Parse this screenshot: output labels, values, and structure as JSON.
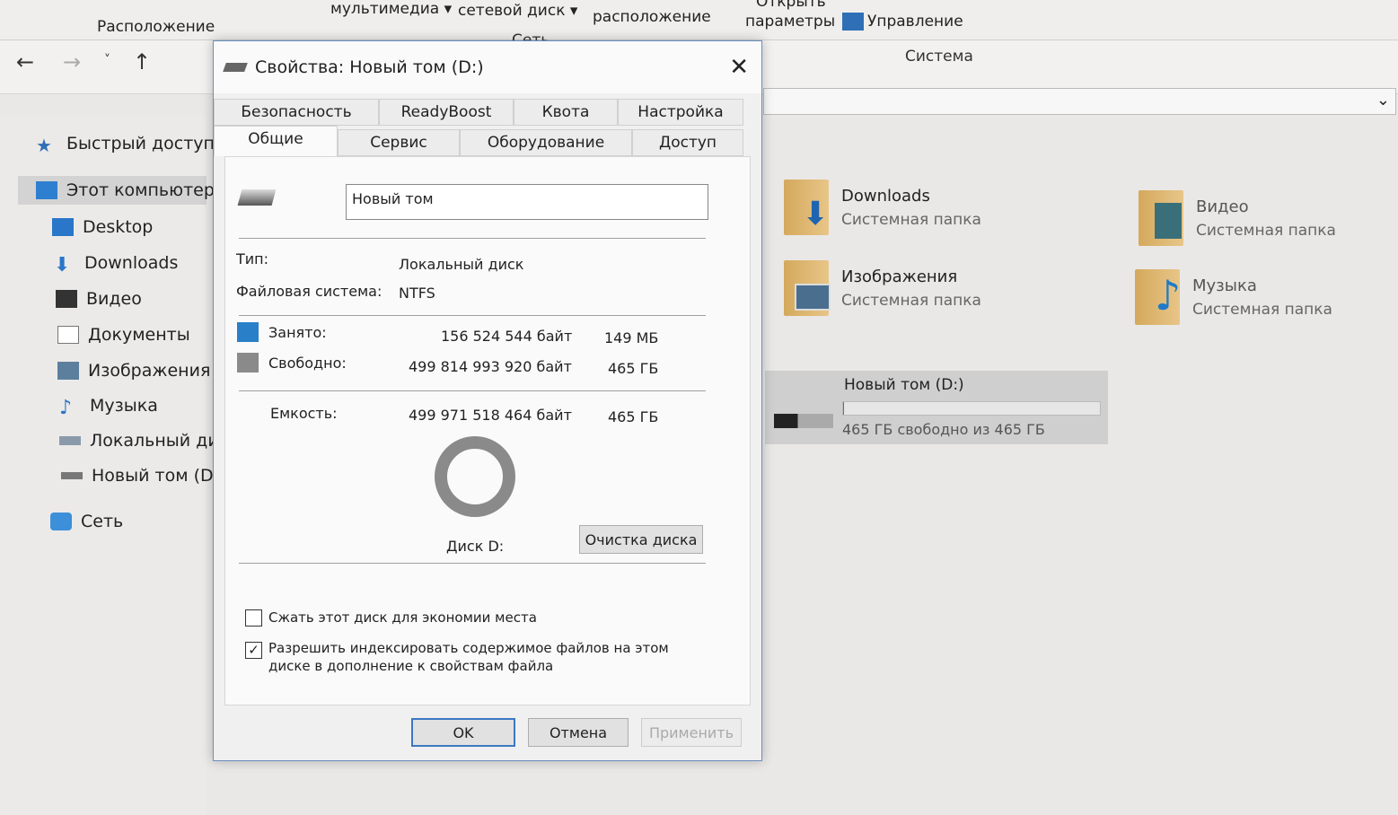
{
  "ribbon": {
    "items": [
      "мультимедиа ▾",
      "сетевой диск ▾",
      "расположение",
      "параметры",
      "Управление",
      "Открыть"
    ],
    "groups": [
      "Расположение",
      "Сеть",
      "Система"
    ]
  },
  "sidebar": {
    "items": [
      {
        "label": "Быстрый доступ",
        "icon": "star-icon"
      },
      {
        "label": "Этот компьютер",
        "icon": "computer-icon"
      },
      {
        "label": "Desktop",
        "icon": "desktop-icon"
      },
      {
        "label": "Downloads",
        "icon": "download-icon"
      },
      {
        "label": "Видео",
        "icon": "video-icon"
      },
      {
        "label": "Документы",
        "icon": "document-icon"
      },
      {
        "label": "Изображения",
        "icon": "image-icon"
      },
      {
        "label": "Музыка",
        "icon": "music-icon"
      },
      {
        "label": "Локальный диск",
        "icon": "drive-icon"
      },
      {
        "label": "Новый том (D:)",
        "icon": "drive-icon"
      },
      {
        "label": "Сеть",
        "icon": "network-icon"
      }
    ]
  },
  "main": {
    "folders": [
      {
        "name": "Downloads",
        "desc": "Системная папка"
      },
      {
        "name": "Видео",
        "desc": "Системная папка"
      },
      {
        "name": "Изображения",
        "desc": "Системная папка"
      },
      {
        "name": "Музыка",
        "desc": "Системная папка"
      }
    ],
    "drive": {
      "name": "Новый том (D:)",
      "free_text": "465 ГБ свободно из 465 ГБ",
      "used_fraction": 0.0003
    }
  },
  "dialog": {
    "title": "Свойства: Новый том (D:)",
    "tabs_back": [
      "Безопасность",
      "ReadyBoost",
      "Квота",
      "Настройка"
    ],
    "tabs_front": [
      "Общие",
      "Сервис",
      "Оборудование",
      "Доступ"
    ],
    "volume_name": "Новый том",
    "type_label": "Тип:",
    "type_value": "Локальный диск",
    "fs_label": "Файловая система:",
    "fs_value": "NTFS",
    "used_label": "Занято:",
    "used_bytes": "156 524 544 байт",
    "used_size": "149 МБ",
    "free_label": "Свободно:",
    "free_bytes": "499 814 993 920 байт",
    "free_size": "465 ГБ",
    "cap_label": "Емкость:",
    "cap_bytes": "499 971 518 464 байт",
    "cap_size": "465 ГБ",
    "disk_label": "Диск D:",
    "cleanup": "Очистка диска",
    "compress": "Сжать этот диск для экономии места",
    "compress_checked": false,
    "index_line1": "Разрешить индексировать содержимое файлов на этом",
    "index_line2": "диске в дополнение к свойствам файла",
    "index_checked": true,
    "ok": "OK",
    "cancel": "Отмена",
    "apply": "Применить",
    "colors": {
      "used": "#2a7fc9",
      "free": "#8a8a8a"
    }
  }
}
